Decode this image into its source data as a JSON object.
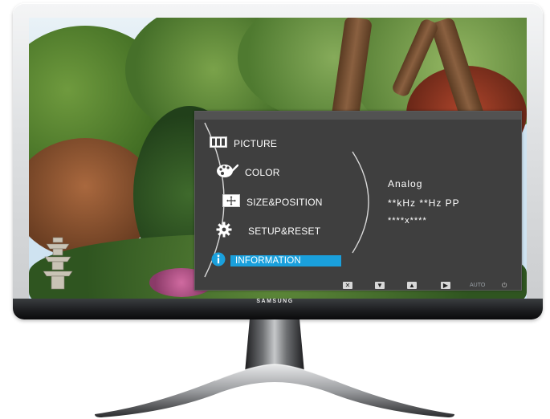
{
  "brand": "SAMSUNG",
  "osd": {
    "menu_items": [
      {
        "label": "PICTURE",
        "icon": "picture-icon"
      },
      {
        "label": "COLOR",
        "icon": "palette-icon"
      },
      {
        "label": "SIZE&POSITION",
        "icon": "size-position-icon"
      },
      {
        "label": "SETUP&RESET",
        "icon": "gear-icon"
      },
      {
        "label": "INFORMATION",
        "icon": "information-icon",
        "selected": true
      }
    ],
    "info": {
      "signal": "Analog",
      "frequency": "**kHz **Hz PP",
      "resolution": "****x****"
    },
    "footer": {
      "exit": "✕",
      "down": "▼",
      "up": "▲",
      "enter": "▶",
      "auto": "AUTO",
      "power": "⏻"
    },
    "accent_color": "#1aa0dc"
  }
}
